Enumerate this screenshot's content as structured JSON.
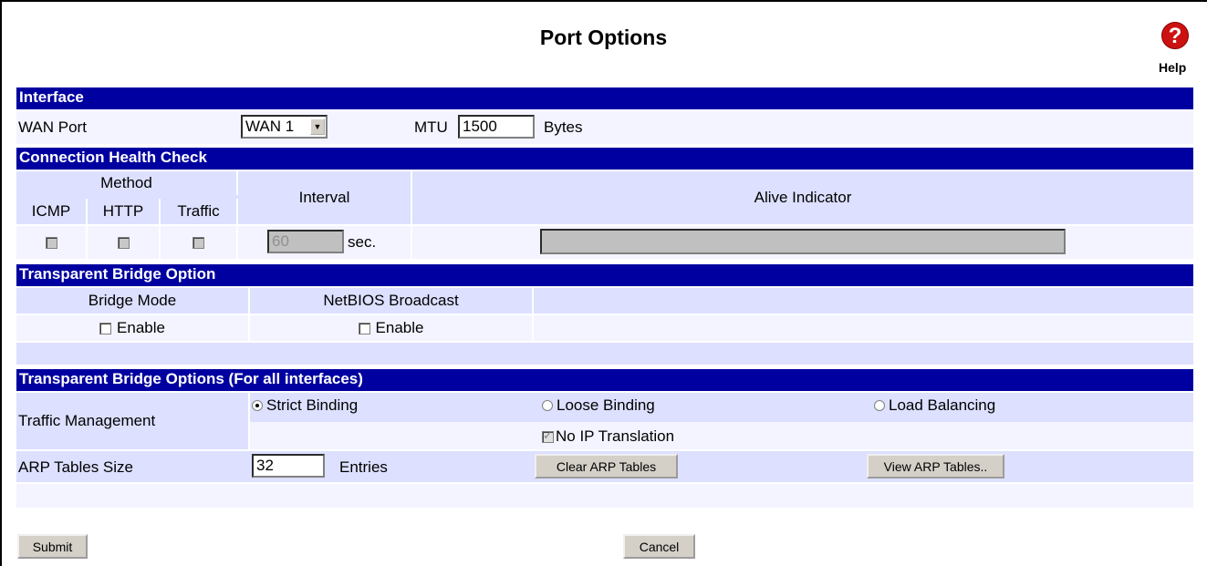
{
  "page": {
    "title": "Port Options",
    "help_label": "Help"
  },
  "interface": {
    "header": "Interface",
    "wan_port_label": "WAN Port",
    "wan_port_value": "WAN 1",
    "mtu_label": "MTU",
    "mtu_value": "1500",
    "mtu_unit": "Bytes"
  },
  "health_check": {
    "header": "Connection Health Check",
    "method_label": "Method",
    "icmp_label": "ICMP",
    "http_label": "HTTP",
    "traffic_label": "Traffic",
    "interval_label": "Interval",
    "alive_label": "Alive Indicator",
    "interval_value": "60",
    "interval_unit": "sec."
  },
  "bridge": {
    "header": "Transparent Bridge Option",
    "bridge_mode_label": "Bridge Mode",
    "netbios_label": "NetBIOS Broadcast",
    "enable_label": "Enable",
    "netbios_enable_label": "Enable"
  },
  "bridge_all": {
    "header": "Transparent Bridge Options (For all interfaces)",
    "traffic_mgmt_label": "Traffic Management",
    "strict_binding": "Strict Binding",
    "loose_binding": "Loose Binding",
    "load_balancing": "Load Balancing",
    "no_ip_translation": "No IP Translation",
    "arp_size_label": "ARP Tables Size",
    "arp_size_value": "32",
    "arp_unit": "Entries",
    "clear_arp": "Clear ARP Tables",
    "view_arp": "View ARP Tables.."
  },
  "footer": {
    "submit": "Submit",
    "cancel": "Cancel"
  }
}
